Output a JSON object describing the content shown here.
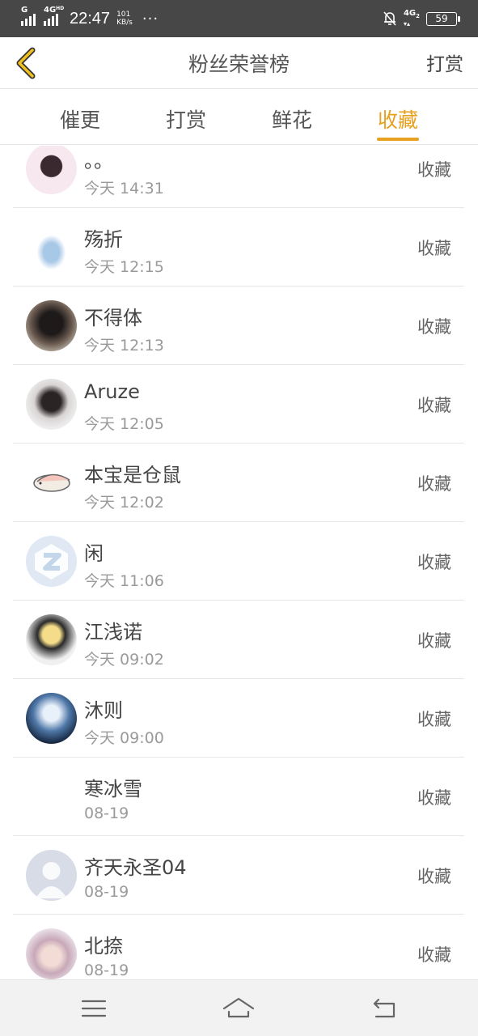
{
  "status_bar": {
    "signal1_label": "G",
    "signal2_label": "4G",
    "signal2_sup": "HD",
    "time": "22:47",
    "speed_value": "101",
    "speed_unit": "KB/s",
    "more": "···",
    "net_right": "4G",
    "net_right_sub": "2",
    "battery": "59",
    "icons": [
      "signal-icon",
      "signal-icon",
      "mute-bell-icon",
      "battery-icon"
    ]
  },
  "header": {
    "title": "粉丝荣誉榜",
    "right_button": "打赏",
    "back_icon": "chevron-left-icon",
    "accent_color": "#e8a020"
  },
  "tabs": [
    {
      "label": "催更",
      "active": false
    },
    {
      "label": "打赏",
      "active": false
    },
    {
      "label": "鲜花",
      "active": false
    },
    {
      "label": "收藏",
      "active": true
    }
  ],
  "list": [
    {
      "name": "。。",
      "time": "今天 14:31",
      "action": "收藏",
      "avatar": "photo-girl-avatar"
    },
    {
      "name": "殇折",
      "time": "今天 12:15",
      "action": "收藏",
      "avatar": "anime-girl-avatar"
    },
    {
      "name": "不得体",
      "time": "今天 12:13",
      "action": "收藏",
      "avatar": "photo-avatar"
    },
    {
      "name": "Aruze",
      "time": "今天 12:05",
      "action": "收藏",
      "avatar": "anime-horned-avatar"
    },
    {
      "name": "本宝是仓鼠",
      "time": "今天 12:02",
      "action": "收藏",
      "avatar": "turtle-avatar"
    },
    {
      "name": "闲",
      "time": "今天 11:06",
      "action": "收藏",
      "avatar": "z-logo-avatar"
    },
    {
      "name": "江浅诺",
      "time": "今天 09:02",
      "action": "收藏",
      "avatar": "anime-blonde-avatar"
    },
    {
      "name": "沐则",
      "time": "今天 09:00",
      "action": "收藏",
      "avatar": "night-tree-avatar"
    },
    {
      "name": "寒冰雪",
      "time": "08-19",
      "action": "收藏",
      "avatar": "none"
    },
    {
      "name": "齐天永圣04",
      "time": "08-19",
      "action": "收藏",
      "avatar": "default-person-avatar"
    },
    {
      "name": "北捺",
      "time": "08-19",
      "action": "收藏",
      "avatar": "photo-hat-girl-avatar"
    }
  ],
  "nav": {
    "icons": [
      "menu-icon",
      "home-icon",
      "back-icon"
    ]
  }
}
